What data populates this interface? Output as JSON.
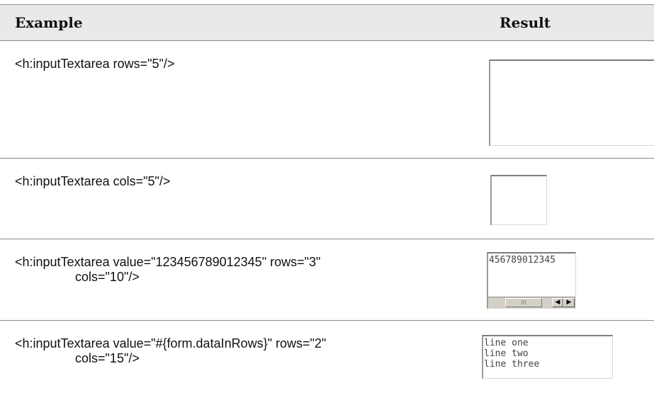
{
  "headers": {
    "example": "Example",
    "result": "Result"
  },
  "rows": [
    {
      "code": "<h:inputTextarea rows=\"5\"/>",
      "result_text": ""
    },
    {
      "code": "<h:inputTextarea cols=\"5\"/>",
      "result_text": ""
    },
    {
      "code": "<h:inputTextarea value=\"123456789012345\" rows=\"3\"\n                 cols=\"10\"/>",
      "result_text": "456789012345"
    },
    {
      "code": "<h:inputTextarea value=\"#{form.dataInRows}\" rows=\"2\"\n                 cols=\"15\"/>",
      "result_text": "line one\nline two\nline three"
    }
  ],
  "scrollbar": {
    "thumb_glyph": "III",
    "left_arrow": "◀",
    "right_arrow": "▶"
  }
}
